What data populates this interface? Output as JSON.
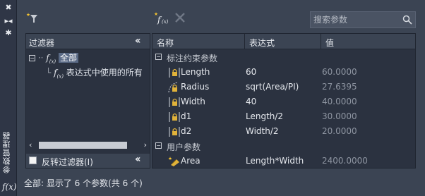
{
  "strip": {
    "title": "参数管理器",
    "icons": [
      "close-icon",
      "pin-icon",
      "properties-icon"
    ],
    "bottom_icon": "fx-icon",
    "bottom_text": "f(x)"
  },
  "toolbar": {
    "filter_icon": "new-filter-icon",
    "new_param_icon": "new-user-parameter-icon",
    "delete_icon": "delete-parameter-icon",
    "search": {
      "placeholder": "搜索参数",
      "value": ""
    }
  },
  "filter_pane": {
    "title": "过滤器",
    "tree": [
      {
        "label": "全部",
        "selected": true,
        "expanded": true
      },
      {
        "label": "表达式中使用的所有",
        "selected": false
      }
    ],
    "invert_label": "反转过滤器(I)",
    "invert_checked": false
  },
  "grid": {
    "columns": [
      "名称",
      "表达式",
      "值"
    ],
    "groups": [
      {
        "label": "标注约束参数",
        "expanded": true,
        "rows": [
          {
            "icon": "linear-dim-lock-icon",
            "name": "Length",
            "expression": "60",
            "value": "60.0000"
          },
          {
            "icon": "radius-lock-icon",
            "name": "Radius",
            "expression": "sqrt(Area/PI)",
            "value": "27.6395"
          },
          {
            "icon": "linear-dim-lock-icon",
            "name": "Width",
            "expression": "40",
            "value": "40.0000"
          },
          {
            "icon": "linear-dim-lock-icon",
            "name": "d1",
            "expression": "Length/2",
            "value": "30.0000"
          },
          {
            "icon": "linear-dim-lock-icon",
            "name": "d2",
            "expression": "Width/2",
            "value": "20.0000"
          }
        ]
      },
      {
        "label": "用户参数",
        "expanded": true,
        "rows": [
          {
            "icon": "user-parameter-icon",
            "name": "Area",
            "expression": "Length*Width",
            "value": "2400.0000"
          }
        ]
      }
    ]
  },
  "status": "全部: 显示了 6 个参数(共 6 个)",
  "colors": {
    "background": "#3b4453",
    "panel": "#2b3240",
    "selection": "#5a6a86",
    "lock": "#e0b23a"
  }
}
